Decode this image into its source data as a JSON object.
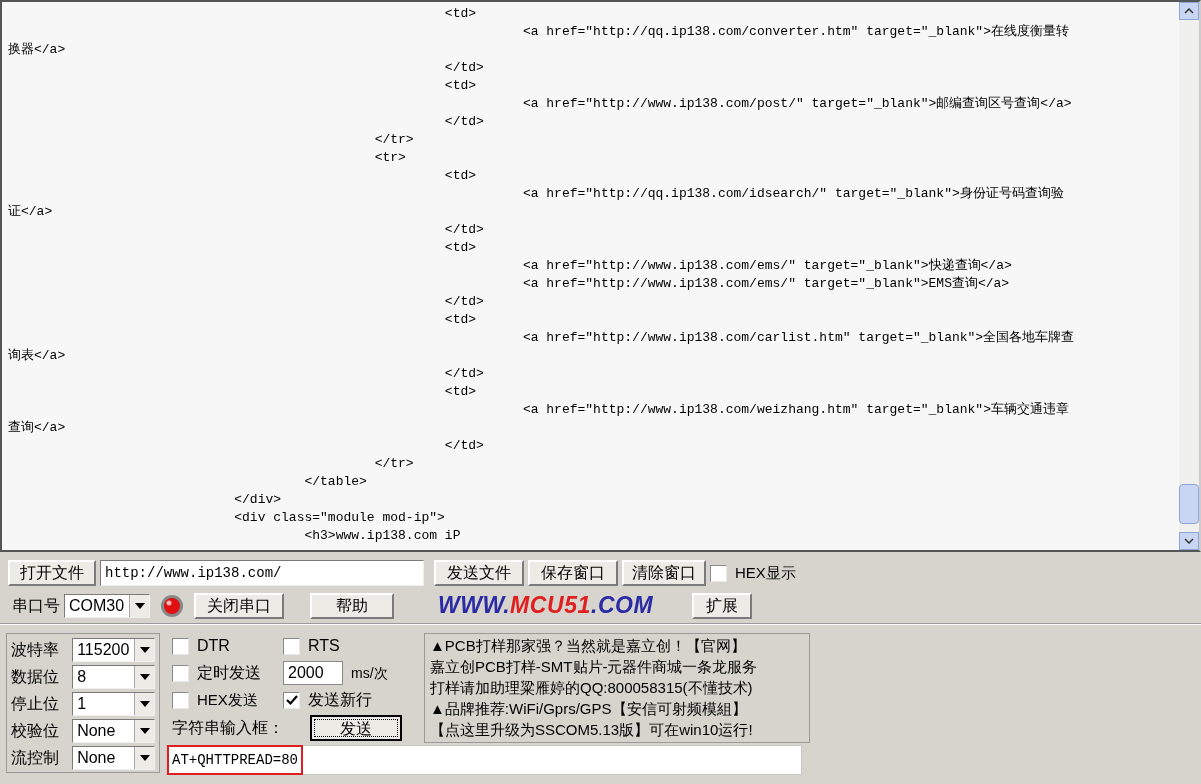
{
  "output": {
    "lines": [
      "                                                        <td>",
      "                                                                  <a href=\"http://qq.ip138.com/converter.htm\" target=\"_blank\">在线度衡量转",
      "换器</a>",
      "                                                        </td>",
      "                                                        <td>",
      "                                                                  <a href=\"http://www.ip138.com/post/\" target=\"_blank\">邮编查询区号查询</a>",
      "                                                        </td>",
      "                                               </tr>",
      "                                               <tr>",
      "                                                        <td>",
      "                                                                  <a href=\"http://qq.ip138.com/idsearch/\" target=\"_blank\">身份证号码查询验",
      "证</a>",
      "                                                        </td>",
      "                                                        <td>",
      "                                                                  <a href=\"http://www.ip138.com/ems/\" target=\"_blank\">快递查询</a>",
      "                                                                  <a href=\"http://www.ip138.com/ems/\" target=\"_blank\">EMS查询</a>",
      "                                                        </td>",
      "                                                        <td>",
      "                                                                  <a href=\"http://www.ip138.com/carlist.htm\" target=\"_blank\">全国各地车牌查",
      "询表</a>",
      "                                                        </td>",
      "                                                        <td>",
      "                                                                  <a href=\"http://www.ip138.com/weizhang.htm\" target=\"_blank\">车辆交通违章",
      "查询</a>",
      "                                                        </td>",
      "                                               </tr>",
      "                                      </table>",
      "                             </div>",
      "                             <div class=\"module mod-ip\">",
      "                                      <h3>www.ip138.com iP"
    ]
  },
  "toolbar": {
    "open_file_button": "打开文件",
    "file_path": "http://www.ip138.com/",
    "send_file_button": "发送文件",
    "save_window_button": "保存窗口",
    "clear_window_button": "清除窗口",
    "hex_display": {
      "label": "HEX显示",
      "checked": false
    }
  },
  "port_row": {
    "port_label": "串口号",
    "port_value": "COM30",
    "port_open": true,
    "close_port_button": "关闭串口",
    "help_button": "帮助",
    "logo_parts": [
      {
        "text": "WWW.",
        "color": "#2b2ba6"
      },
      {
        "text": "MCU51",
        "color": "#e02020"
      },
      {
        "text": ".COM",
        "color": "#2b2ba6"
      }
    ],
    "expand_button": "扩展"
  },
  "settings": [
    {
      "label": "波特率",
      "value": "115200"
    },
    {
      "label": "数据位",
      "value": "8"
    },
    {
      "label": "停止位",
      "value": "1"
    },
    {
      "label": "校验位",
      "value": "None"
    },
    {
      "label": "流控制",
      "value": "None"
    }
  ],
  "options": {
    "dtr": {
      "label": "DTR",
      "checked": false
    },
    "rts": {
      "label": "RTS",
      "checked": false
    },
    "timed_send": {
      "label": "定时发送",
      "checked": false
    },
    "interval": "2000",
    "interval_unit": "ms/次",
    "hex_send": {
      "label": "HEX发送",
      "checked": false
    },
    "send_newline": {
      "label": "发送新行",
      "checked": true
    },
    "string_input_label": "字符串输入框：",
    "send_button": "发送"
  },
  "ad_lines": [
    "▲PCB打样那家强？当然就是嘉立创！【官网】",
    "嘉立创PCB打样-SMT贴片-元器件商城一条龙服务",
    "打样请加助理粱雁婷的QQ:800058315(不懂技术)",
    "▲品牌推荐:WiFi/Gprs/GPS【安信可射频模組】",
    "【点这里升级为SSCOM5.13版】可在win10运行!"
  ],
  "send_input": {
    "value": "AT+QHTTPREAD=80",
    "highlighted": true
  }
}
